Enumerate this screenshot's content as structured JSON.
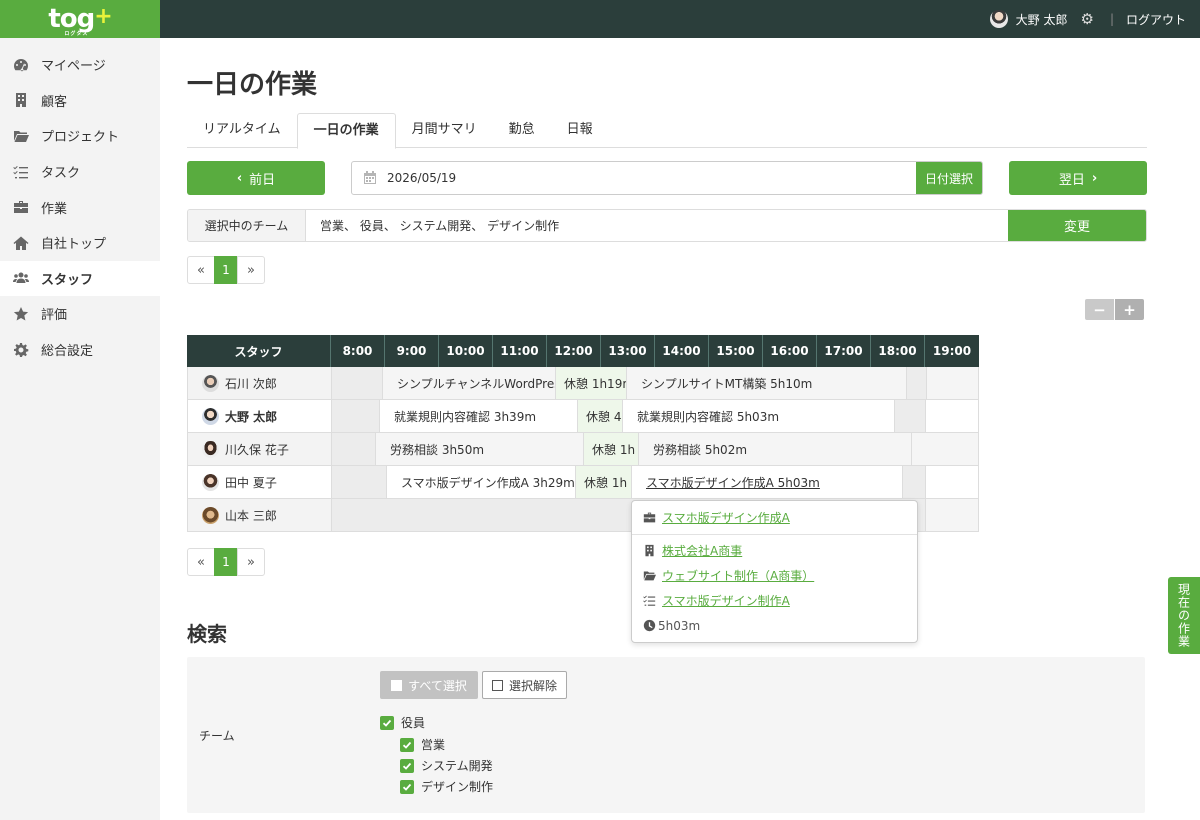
{
  "app": {
    "logo": "tog",
    "logo_plus": "+",
    "logo_sub": "ログタス"
  },
  "header": {
    "user_name": "大野 太郎",
    "separator": "|",
    "logout": "ログアウト"
  },
  "sidebar": {
    "items": [
      {
        "label": "マイページ",
        "icon": "dashboard-icon"
      },
      {
        "label": "顧客",
        "icon": "building-icon"
      },
      {
        "label": "プロジェクト",
        "icon": "folder-icon"
      },
      {
        "label": "タスク",
        "icon": "task-list-icon"
      },
      {
        "label": "作業",
        "icon": "briefcase-icon"
      },
      {
        "label": "自社トップ",
        "icon": "home-icon"
      },
      {
        "label": "スタッフ",
        "icon": "users-icon",
        "active": true
      },
      {
        "label": "評価",
        "icon": "star-icon"
      },
      {
        "label": "総合設定",
        "icon": "gear-icon"
      }
    ]
  },
  "page": {
    "title": "一日の作業"
  },
  "tabs": [
    {
      "label": "リアルタイム"
    },
    {
      "label": "一日の作業",
      "active": true
    },
    {
      "label": "月間サマリ"
    },
    {
      "label": "勤怠"
    },
    {
      "label": "日報"
    }
  ],
  "nav": {
    "prev": "前日",
    "next": "翌日",
    "date": "2026/05/19",
    "date_pick": "日付選択"
  },
  "team": {
    "label": "選択中のチーム",
    "value": "営業、 役員、 システム開発、 デザイン制作",
    "change": "変更"
  },
  "pager": {
    "first": "«",
    "current": "1",
    "last": "»"
  },
  "zoom": {
    "minus": "−",
    "plus": "+"
  },
  "schedule": {
    "staff_header": "スタッフ",
    "hours": [
      "8:00",
      "9:00",
      "10:00",
      "11:00",
      "12:00",
      "13:00",
      "14:00",
      "15:00",
      "16:00",
      "17:00",
      "18:00",
      "19:00"
    ],
    "rows": [
      {
        "name": "石川 次郎",
        "blocks": [
          "シンプルチャンネルWordPress",
          "休憩 1h19m",
          "シンプルサイトMT構築 5h10m"
        ]
      },
      {
        "name": "大野 太郎",
        "blocks": [
          "就業規則内容確認 3h39m",
          "休憩 4",
          "就業規則内容確認 5h03m"
        ]
      },
      {
        "name": "川久保 花子",
        "blocks": [
          "労務相談 3h50m",
          "休憩 1h",
          "労務相談 5h02m"
        ]
      },
      {
        "name": "田中 夏子",
        "blocks": [
          "スマホ版デザイン作成A 3h29m",
          "休憩 1h",
          "スマホ版デザイン作成A 5h03m"
        ]
      },
      {
        "name": "山本 三郎",
        "blocks": []
      }
    ]
  },
  "popover": {
    "work": "スマホ版デザイン作成A",
    "client": "株式会社A商事",
    "project": "ウェブサイト制作（A商事）",
    "task": "スマホ版デザイン制作A",
    "duration": "5h03m"
  },
  "search": {
    "title": "検索",
    "team_label": "チーム",
    "select_all": "すべて選択",
    "deselect": "選択解除",
    "teams": [
      {
        "label": "役員",
        "level": 0
      },
      {
        "label": "営業",
        "level": 1
      },
      {
        "label": "システム開発",
        "level": 1
      },
      {
        "label": "デザイン制作",
        "level": 1
      }
    ]
  },
  "float_tab": "現在の作業",
  "colors": {
    "accent": "#59ac3f",
    "header": "#2b3e3b",
    "logo_plus": "#e8f23a"
  }
}
